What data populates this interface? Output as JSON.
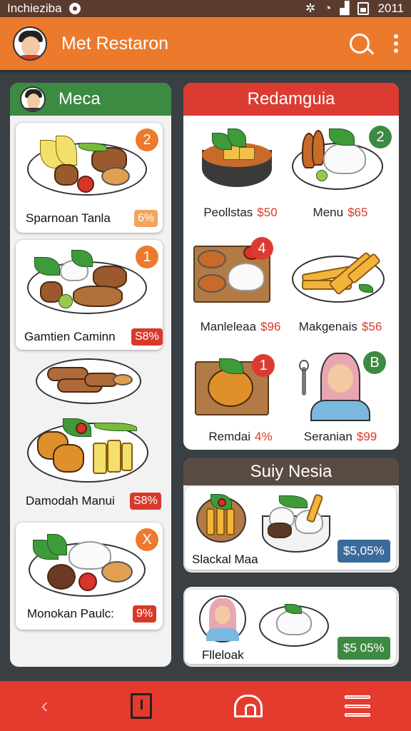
{
  "status_bar": {
    "carrier": "Inchieziba",
    "time": "2011"
  },
  "app_bar": {
    "title": "Met Restaron",
    "search_icon": "search-icon",
    "more_icon": "more-vert-icon"
  },
  "left_panel": {
    "title": "Meca",
    "items": [
      {
        "label": "Sparnoan Tanla",
        "price": "6%",
        "badge": "2",
        "badge_color": "#ec7a2c",
        "price_color": "#f2a45a"
      },
      {
        "label": "Gamtien Caminn",
        "price": "S8%",
        "badge": "1",
        "badge_color": "#ec7a2c",
        "price_color": "#d83a2a"
      },
      {
        "label": "Damodah Manui",
        "price": "S8%",
        "badge": "",
        "badge_color": "",
        "price_color": "#d83a2a"
      },
      {
        "label": "Monokan Paulc:",
        "price": "9%",
        "badge": "X",
        "badge_color": "#ec7a2c",
        "price_color": "#d83a2a"
      }
    ]
  },
  "right_top_panel": {
    "title": "Redamguia",
    "items": [
      {
        "name": "Peollstas",
        "price": "$50",
        "badge": ""
      },
      {
        "name": "Menu",
        "price": "$65",
        "badge": "2"
      },
      {
        "name": "Manleleaa",
        "price": "$96",
        "badge": "4"
      },
      {
        "name": "Makgenais",
        "price": "$56",
        "badge": ""
      },
      {
        "name": "Remdai",
        "price": "4%",
        "badge": "1"
      },
      {
        "name": "Seranian",
        "price": "$99",
        "badge": "B"
      }
    ]
  },
  "right_mid_panel": {
    "title": "Suiy Nesia",
    "item": {
      "name": "Slackal Maa",
      "price": "$5,05%",
      "price_color": "#3a6a9a"
    }
  },
  "right_bot_panel": {
    "item": {
      "name": "Flleloak",
      "price": "$5 05%",
      "price_color": "#3d8a43"
    }
  },
  "bottom_nav": {
    "items": [
      "back-icon",
      "share-icon",
      "home-icon",
      "menu-icon"
    ]
  }
}
